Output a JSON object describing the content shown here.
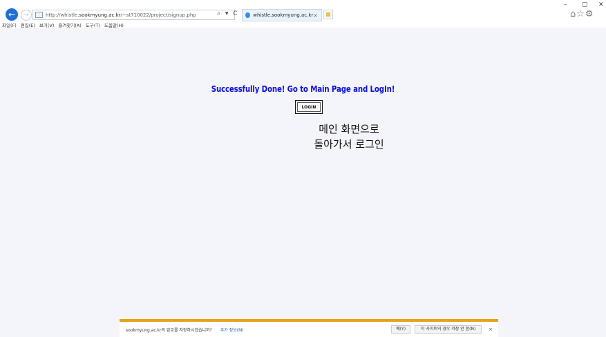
{
  "browser": {
    "url_prefix": "http://whistle.",
    "url_host": "sookmyung.ac.kr",
    "url_rest": "/~st710022/project/signup.php",
    "address_tools": "⌕ ▾ C",
    "tab_title": "whistle.sookmyung.ac.kr",
    "tab_close": "×",
    "window_controls": {
      "minimize": "–",
      "restore": "▢",
      "close": "✕"
    },
    "right_icons": "⌂☆⚙"
  },
  "menubar": [
    "파일(F)",
    "편집(E)",
    "보기(V)",
    "즐겨찾기(A)",
    "도구(T)",
    "도움말(H)"
  ],
  "content": {
    "message": "Successfully Done! Go to Main Page and LogIn!",
    "login_button": "LOGIN",
    "annotation_line1": "메인 화면으로",
    "annotation_line2": "돌아가서 로그인"
  },
  "notification": {
    "text": "sookmyung.ac.kr의 암호를 저장하시겠습니까?",
    "link": "추가 정보(M)",
    "yes_button": "예(Y)",
    "never_button": "이 사이트의 경우 저장 안 함(N)",
    "close": "×"
  },
  "colors": {
    "message": "#0c10d8",
    "notification_border": "#e8a316",
    "page_background": "#f4f4fb"
  }
}
